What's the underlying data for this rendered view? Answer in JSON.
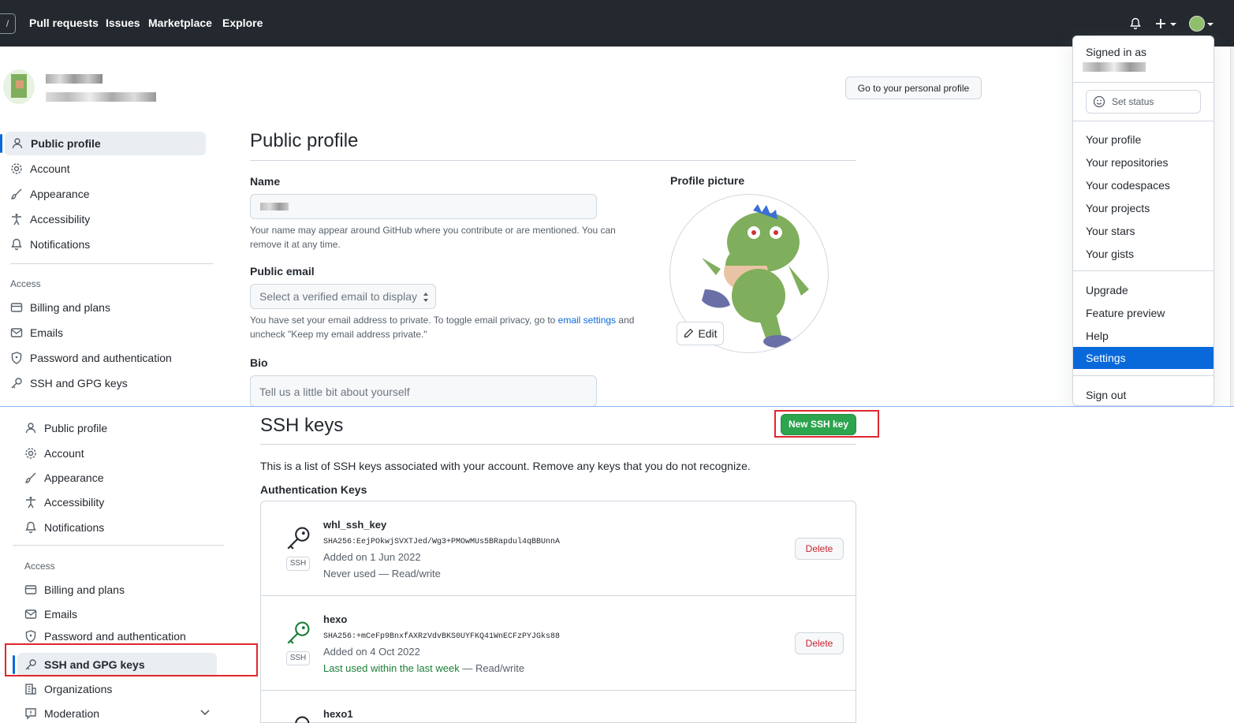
{
  "header": {
    "nav": [
      "Pull requests",
      "Issues",
      "Marketplace",
      "Explore"
    ]
  },
  "top": {
    "go_profile": "Go to your personal profile",
    "sidebar": {
      "items": [
        "Public profile",
        "Account",
        "Appearance",
        "Accessibility",
        "Notifications"
      ],
      "access_heading": "Access",
      "access_items": [
        "Billing and plans",
        "Emails",
        "Password and authentication",
        "SSH and GPG keys"
      ]
    },
    "main": {
      "title": "Public profile",
      "name_label": "Name",
      "name_note": "Your name may appear around GitHub where you contribute or are mentioned. You can remove it at any time.",
      "email_label": "Public email",
      "email_select": "Select a verified email to display",
      "email_note_1": "You have set your email address to private. To toggle email privacy, go to",
      "email_note_link": "email settings",
      "email_note_2": "and uncheck \"Keep my email address private.\"",
      "bio_label": "Bio",
      "bio_placeholder": "Tell us a little bit about yourself",
      "picture_label": "Profile picture",
      "edit_label": "Edit"
    }
  },
  "dropdown": {
    "signed_in_as": "Signed in as",
    "set_status": "Set status",
    "group1": [
      "Your profile",
      "Your repositories",
      "Your codespaces",
      "Your projects",
      "Your stars",
      "Your gists"
    ],
    "group2": [
      "Upgrade",
      "Feature preview",
      "Help"
    ],
    "selected": "Settings",
    "sign_out": "Sign out"
  },
  "bottom": {
    "sidebar": {
      "items": [
        "Public profile",
        "Account",
        "Appearance",
        "Accessibility",
        "Notifications"
      ],
      "access_heading": "Access",
      "access_items": [
        "Billing and plans",
        "Emails",
        "Password and authentication",
        "SSH and GPG keys",
        "Organizations",
        "Moderation"
      ]
    },
    "main": {
      "title": "SSH keys",
      "new_key_button": "New SSH key",
      "description": "This is a list of SSH keys associated with your account. Remove any keys that you do not recognize.",
      "auth_heading": "Authentication Keys",
      "keys": [
        {
          "name": "whl_ssh_key",
          "fingerprint": "SHA256:EejPOkwjSVXTJed/Wg3+PMOwMUs5BRapdul4qBBUnnA",
          "added": "Added on 1 Jun 2022",
          "used": "Never used",
          "access": " — Read/write",
          "badge": "SSH",
          "delete": "Delete",
          "recent": false
        },
        {
          "name": "hexo",
          "fingerprint": "SHA256:+mCeFp9BnxfAXRzVdvBKS0UYFKQ41WnECFzPYJGks88",
          "added": "Added on 4 Oct 2022",
          "used": "Last used within the last week",
          "access": " — Read/write",
          "badge": "SSH",
          "delete": "Delete",
          "recent": true
        },
        {
          "name": "hexo1"
        }
      ]
    }
  },
  "colors": {
    "header_bg": "#24292f",
    "accent_blue": "#0969da",
    "green_button": "#2da44e",
    "danger": "#cf222e",
    "highlight_box": "#e0262e"
  }
}
